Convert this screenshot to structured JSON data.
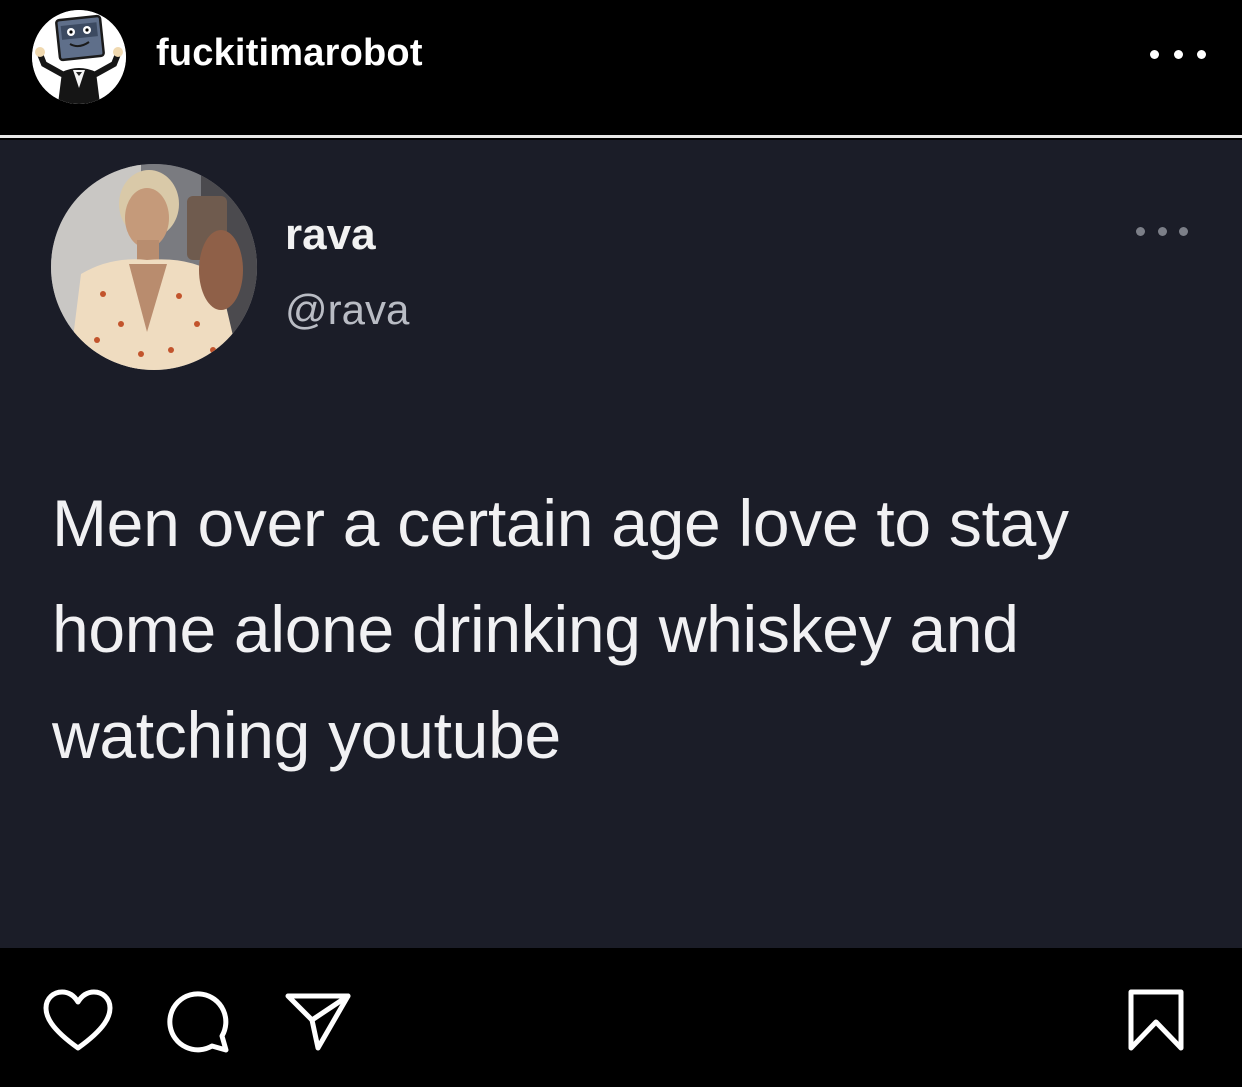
{
  "post": {
    "username": "fuckitimarobot",
    "avatar_icon": "robot-mascot-avatar",
    "more_icon": "more-options-icon"
  },
  "tweet": {
    "display_name": "rava",
    "handle": "@rava",
    "text": "Men over a certain age love to stay home alone drinking whiskey and watching youtube",
    "more_icon": "more-options-icon"
  },
  "actions": {
    "like_icon": "heart-icon",
    "comment_icon": "comment-icon",
    "share_icon": "send-icon",
    "save_icon": "bookmark-icon"
  },
  "colors": {
    "app_background": "#000000",
    "card_background": "#1b1d28",
    "text_primary": "#f1f1f3",
    "text_secondary": "#b9bcc4"
  }
}
